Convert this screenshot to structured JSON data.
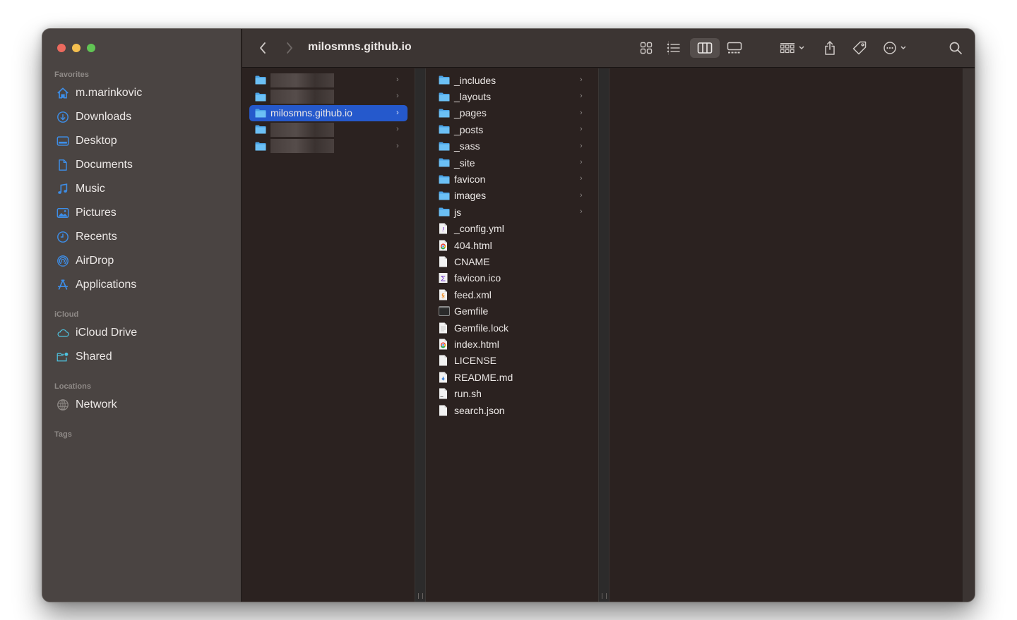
{
  "window": {
    "title": "milosmns.github.io"
  },
  "sidebar": {
    "sections": [
      {
        "heading": "Favorites",
        "items": [
          {
            "label": "m.marinkovic",
            "icon": "home-icon"
          },
          {
            "label": "Downloads",
            "icon": "download-icon"
          },
          {
            "label": "Desktop",
            "icon": "desktop-icon"
          },
          {
            "label": "Documents",
            "icon": "document-icon"
          },
          {
            "label": "Music",
            "icon": "music-icon"
          },
          {
            "label": "Pictures",
            "icon": "pictures-icon"
          },
          {
            "label": "Recents",
            "icon": "clock-icon"
          },
          {
            "label": "AirDrop",
            "icon": "airdrop-icon"
          },
          {
            "label": "Applications",
            "icon": "applications-icon"
          }
        ]
      },
      {
        "heading": "iCloud",
        "items": [
          {
            "label": "iCloud Drive",
            "icon": "cloud-icon"
          },
          {
            "label": "Shared",
            "icon": "shared-folder-icon"
          }
        ]
      },
      {
        "heading": "Locations",
        "items": [
          {
            "label": "Network",
            "icon": "globe-icon"
          }
        ]
      },
      {
        "heading": "Tags",
        "items": []
      }
    ]
  },
  "toolbar": {
    "back": "back-icon",
    "forward": "forward-icon",
    "views": [
      "icon-view",
      "list-view",
      "column-view",
      "gallery-view"
    ],
    "active_view": "column-view",
    "group": "group-icon",
    "share": "share-icon",
    "tags": "tag-icon",
    "more": "more-icon",
    "search": "search-icon"
  },
  "columns": {
    "column1": [
      {
        "name": "",
        "type": "folder",
        "redacted": true
      },
      {
        "name": "",
        "type": "folder",
        "redacted": true
      },
      {
        "name": "milosmns.github.io",
        "type": "folder",
        "selected": true
      },
      {
        "name": "",
        "type": "folder",
        "redacted": true
      },
      {
        "name": "",
        "type": "folder",
        "redacted": true
      }
    ],
    "column2": [
      {
        "name": "_includes",
        "type": "folder"
      },
      {
        "name": "_layouts",
        "type": "folder"
      },
      {
        "name": "_pages",
        "type": "folder"
      },
      {
        "name": "_posts",
        "type": "folder"
      },
      {
        "name": "_sass",
        "type": "folder"
      },
      {
        "name": "_site",
        "type": "folder"
      },
      {
        "name": "favicon",
        "type": "folder"
      },
      {
        "name": "images",
        "type": "folder"
      },
      {
        "name": "js",
        "type": "folder"
      },
      {
        "name": "_config.yml",
        "type": "yml"
      },
      {
        "name": "404.html",
        "type": "html"
      },
      {
        "name": "CNAME",
        "type": "plain"
      },
      {
        "name": "favicon.ico",
        "type": "ico"
      },
      {
        "name": "feed.xml",
        "type": "xml"
      },
      {
        "name": "Gemfile",
        "type": "exec"
      },
      {
        "name": "Gemfile.lock",
        "type": "text"
      },
      {
        "name": "index.html",
        "type": "html"
      },
      {
        "name": "LICENSE",
        "type": "plain"
      },
      {
        "name": "README.md",
        "type": "md"
      },
      {
        "name": "run.sh",
        "type": "script"
      },
      {
        "name": "search.json",
        "type": "plain"
      }
    ]
  },
  "colors": {
    "accent": "#2559cc",
    "folder": "#5cb3f0",
    "sidebar_icon": "#3d8ee8",
    "icloud_icon": "#4ec3e0"
  }
}
